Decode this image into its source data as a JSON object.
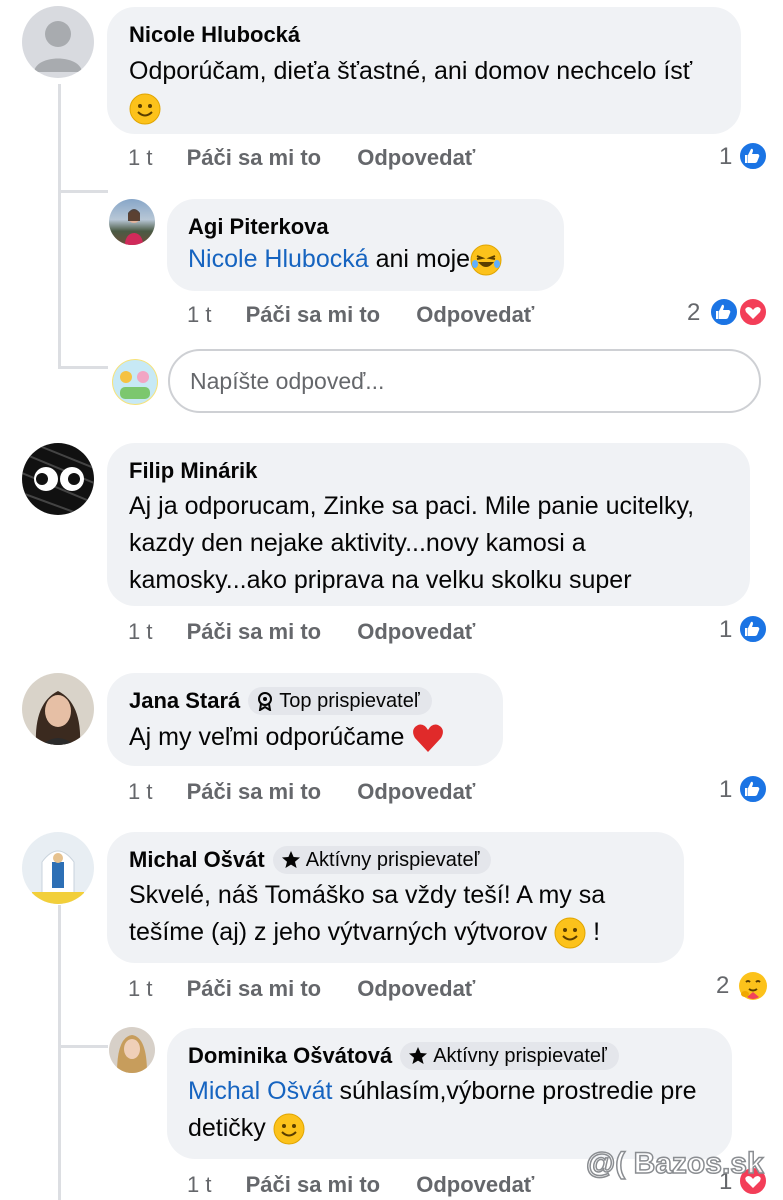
{
  "comments": [
    {
      "author": "Nicole Hlubocká",
      "text": "Odporúčam, dieťa šťastné, ani domov nechcelo ísť",
      "time": "1 t",
      "like": "Páči sa mi to",
      "reply": "Odpovedať",
      "reactions": "1",
      "replies": [
        {
          "author": "Agi Piterkova",
          "mention": "Nicole Hlubocká",
          "text": "ani moje",
          "time": "1 t",
          "like": "Páči sa mi to",
          "reply": "Odpovedať",
          "reactions": "2"
        }
      ],
      "reply_placeholder": "Napíšte odpoveď..."
    },
    {
      "author": "Filip Minárik",
      "text": "Aj ja odporucam, Zinke sa paci. Mile panie ucitelky, kazdy den nejake aktivity...novy kamosi a kamosky...ako priprava na velku skolku super",
      "time": "1 t",
      "like": "Páči sa mi to",
      "reply": "Odpovedať",
      "reactions": "1"
    },
    {
      "author": "Jana Stará",
      "badge": "Top prispievateľ",
      "text": "Aj my veľmi odporúčame",
      "time": "1 t",
      "like": "Páči sa mi to",
      "reply": "Odpovedať",
      "reactions": "1"
    },
    {
      "author": "Michal Ošvát",
      "badge": "Aktívny prispievateľ",
      "text": "Skvelé, náš Tomáško sa vždy teší! A my sa tešíme (aj) z jeho výtvarných výtvorov",
      "text_end": "!",
      "time": "1 t",
      "like": "Páči sa mi to",
      "reply": "Odpovedať",
      "reactions": "2",
      "replies": [
        {
          "author": "Dominika Ošvátová",
          "badge": "Aktívny prispievateľ",
          "mention": "Michal Ošvát",
          "text": "súhlasím,výborne prostredie pre detičky",
          "time": "1 t",
          "like": "Páči sa mi to",
          "reply": "Odpovedať",
          "reactions": "1"
        }
      ]
    }
  ],
  "watermark": "@( Bazos.sk",
  "colors": {
    "bubble": "#f0f2f5",
    "link": "#1664c0",
    "meta": "#65676b",
    "like": "#1b74e4",
    "heart": "#f33e58"
  }
}
